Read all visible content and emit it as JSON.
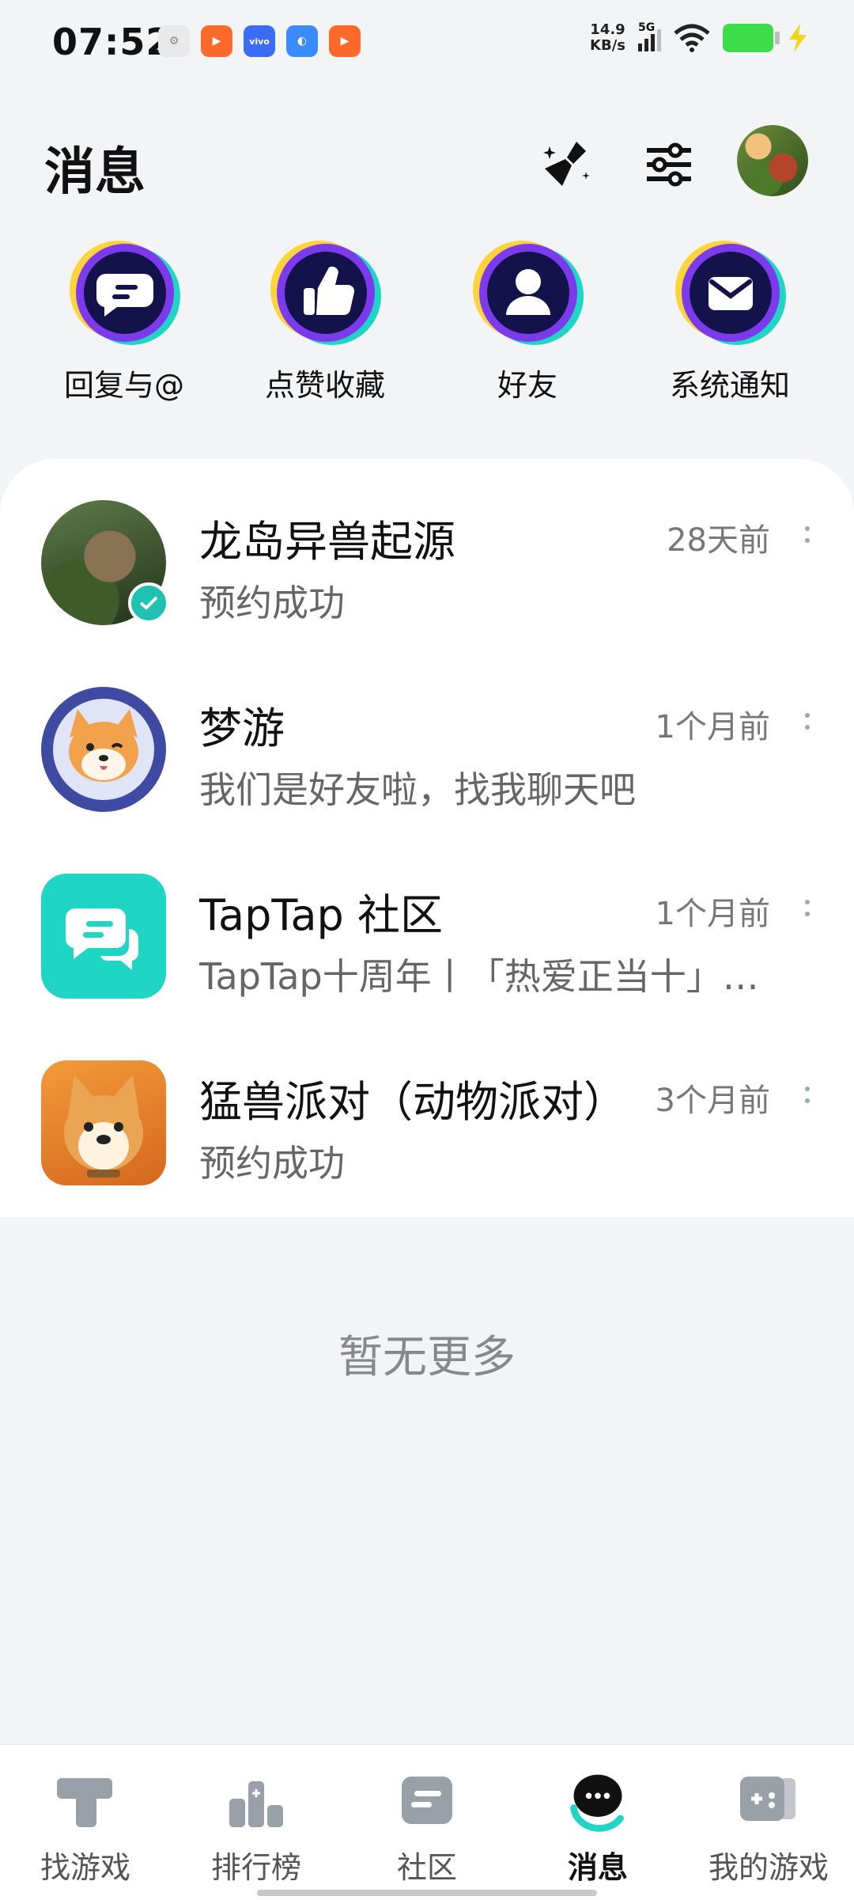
{
  "status_bar": {
    "time": "07:52",
    "speed_value": "14.9",
    "speed_unit": "KB/s",
    "network": "5G"
  },
  "header": {
    "title": "消息",
    "icons": [
      "clean-broom-icon",
      "filter-sliders-icon",
      "user-avatar"
    ]
  },
  "categories": [
    {
      "label": "回复与@",
      "icon": "chat-bubble-icon"
    },
    {
      "label": "点赞收藏",
      "icon": "thumbs-up-icon"
    },
    {
      "label": "好友",
      "icon": "person-icon"
    },
    {
      "label": "系统通知",
      "icon": "envelope-icon"
    }
  ],
  "messages": [
    {
      "title": "龙岛异兽起源",
      "subtitle": "预约成功",
      "time": "28天前"
    },
    {
      "title": "梦游",
      "subtitle": "我们是好友啦，找我聊天吧",
      "time": "1个月前"
    },
    {
      "title": "TapTap 社区",
      "subtitle": "TapTap十周年丨「热爱正当十」…",
      "time": "1个月前"
    },
    {
      "title": "猛兽派对（动物派对）",
      "subtitle": "预约成功",
      "time": "3个月前"
    }
  ],
  "empty_text": "暂无更多",
  "nav": [
    {
      "label": "找游戏",
      "icon": "find-game-icon"
    },
    {
      "label": "排行榜",
      "icon": "ranking-icon"
    },
    {
      "label": "社区",
      "icon": "community-icon"
    },
    {
      "label": "消息",
      "icon": "message-icon",
      "active": true
    },
    {
      "label": "我的游戏",
      "icon": "my-games-icon"
    }
  ],
  "colors": {
    "accent_teal": "#1fd6c5",
    "icon_navy": "#14124a",
    "icon_purple": "#7c3aed",
    "icon_yellow": "#ffd43b"
  }
}
